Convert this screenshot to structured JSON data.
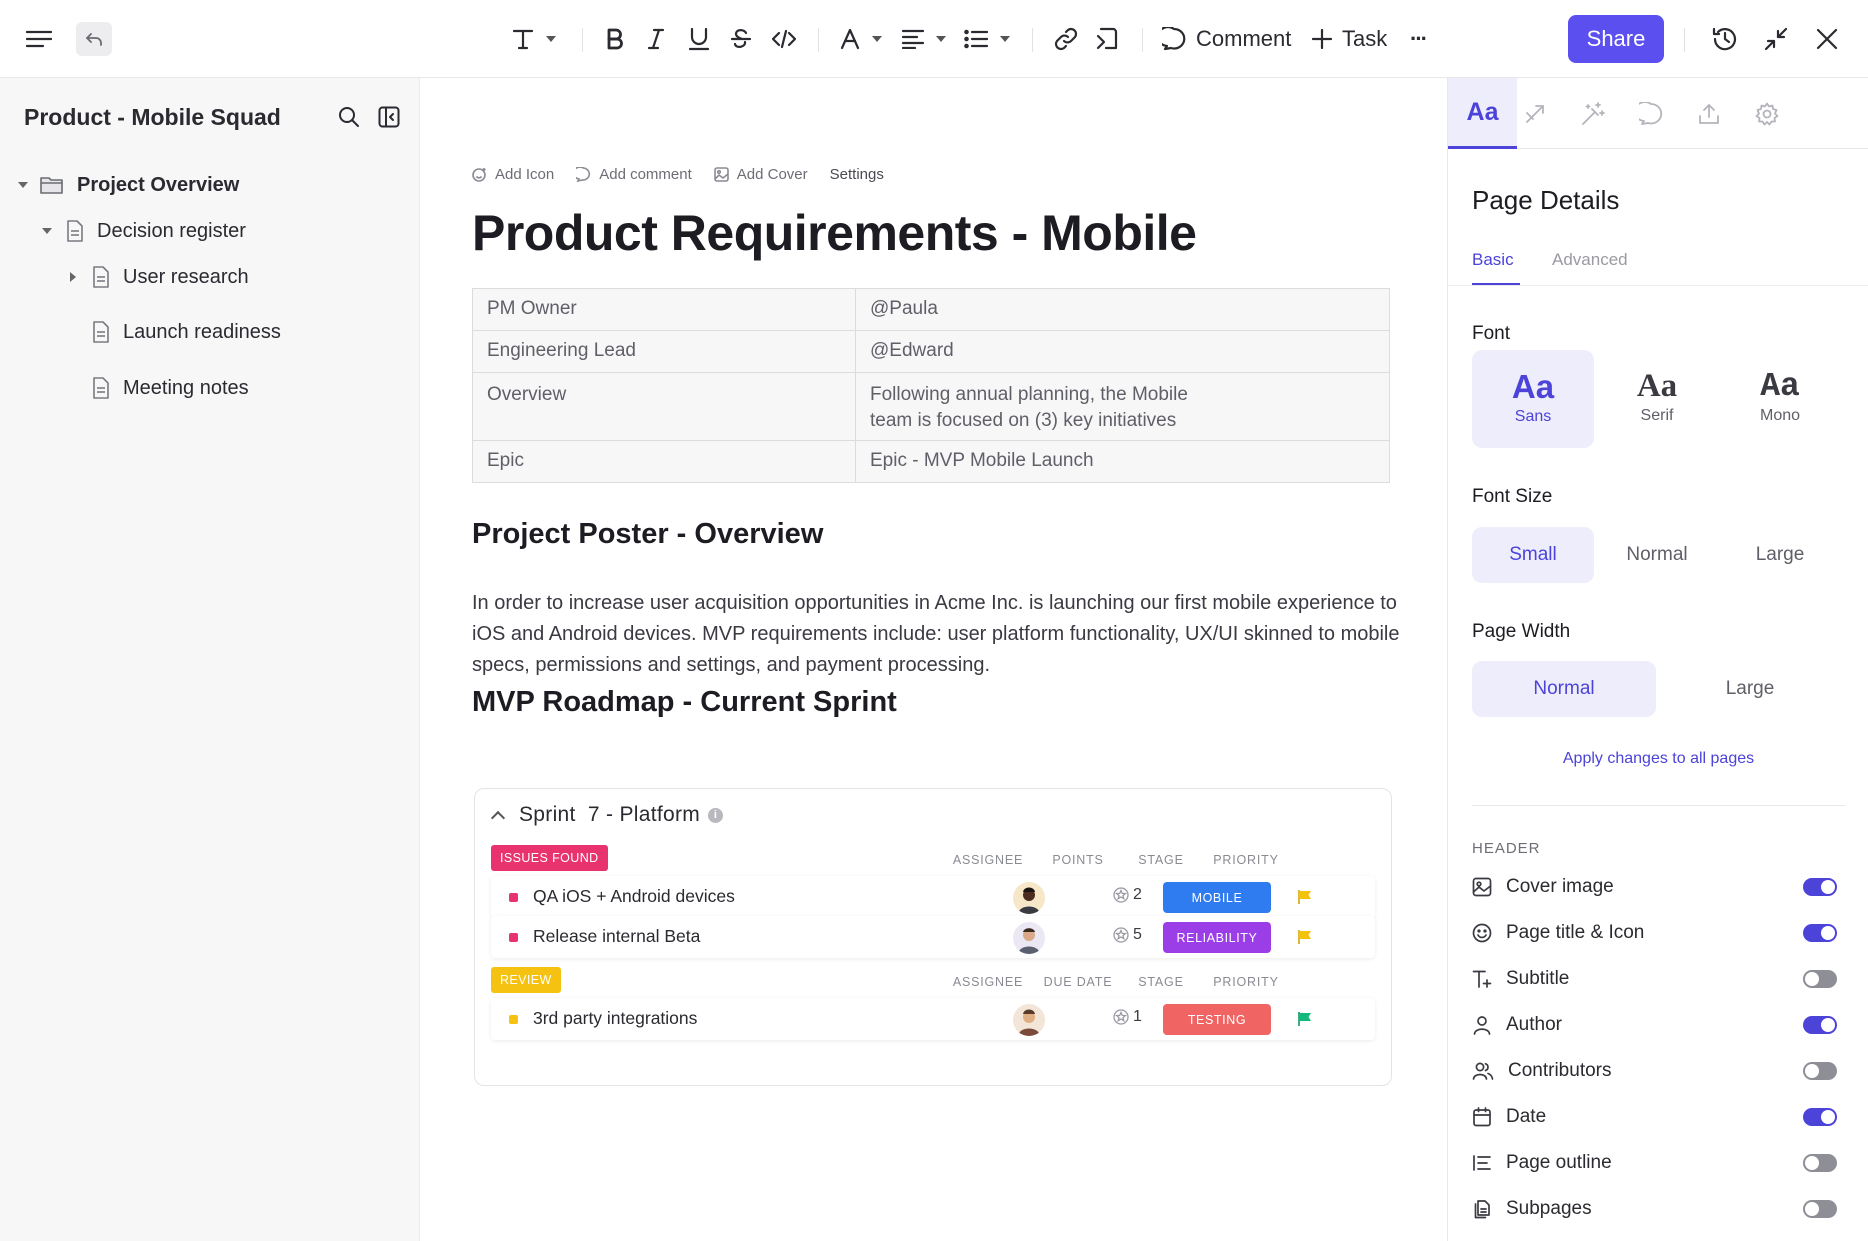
{
  "toolbar": {
    "comment_label": "Comment",
    "task_label": "Task",
    "more_label": "···",
    "share_label": "Share"
  },
  "sidebar": {
    "title": "Product - Mobile Squad",
    "tree": [
      {
        "label": "Project Overview",
        "level": 0,
        "expanded": true
      },
      {
        "label": "Decision register",
        "level": 1,
        "expanded": true
      },
      {
        "label": "User research",
        "level": 2,
        "expanded": false
      },
      {
        "label": "Launch readiness",
        "level": 2
      },
      {
        "label": "Meeting notes",
        "level": 2
      }
    ]
  },
  "doc": {
    "actions": {
      "add_icon": "Add Icon",
      "add_comment": "Add comment",
      "add_cover": "Add Cover",
      "settings": "Settings"
    },
    "title": "Product Requirements - Mobile",
    "properties": [
      {
        "key": "PM Owner",
        "value": "@Paula"
      },
      {
        "key": "Engineering Lead",
        "value": "@Edward"
      },
      {
        "key": "Overview",
        "value_line1": "Following annual planning, the Mobile",
        "value_line2": "team is focused on (3) key initiatives"
      },
      {
        "key": "Epic",
        "value": "Epic - MVP Mobile Launch"
      }
    ],
    "poster_heading": "Project Poster - Overview",
    "poster_body": "In order to increase user acquisition opportunities in Acme Inc. is launching our first mobile experience to iOS and Android devices. MVP requirements include: user platform functionality, UX/UI skinned to mobile specs, permissions and settings, and payment processing.",
    "roadmap_heading": "MVP Roadmap - Current Sprint",
    "sprint": {
      "title": "Sprint  7 - Platform",
      "info_glyph": "i",
      "groups": [
        {
          "tag": "ISSUES FOUND",
          "tag_color": "#e8336f",
          "columns": [
            "ASSIGNEE",
            "POINTS",
            "STAGE",
            "PRIORITY"
          ],
          "tasks": [
            {
              "name": "QA iOS + Android devices",
              "points": "2",
              "stage": "MOBILE",
              "stage_color": "#2f7bf0",
              "square_color": "#e8336f",
              "flag_color": "#f3c20d"
            },
            {
              "name": "Release internal Beta",
              "points": "5",
              "stage": "RELIABILITY",
              "stage_color": "#9b3ee8",
              "square_color": "#e8336f",
              "flag_color": "#f3c20d"
            }
          ]
        },
        {
          "tag": "REVIEW",
          "tag_color": "#f5c211",
          "columns": [
            "ASSIGNEE",
            "DUE DATE",
            "STAGE",
            "PRIORITY"
          ],
          "tasks": [
            {
              "name": "3rd party integrations",
              "points": "1",
              "stage": "TESTING",
              "stage_color": "#f06464",
              "square_color": "#f5c211",
              "flag_color": "#14b87a"
            }
          ]
        }
      ]
    }
  },
  "panel": {
    "active_tab": "Aa",
    "title": "Page Details",
    "subtabs": {
      "basic": "Basic",
      "advanced": "Advanced"
    },
    "font_label": "Font",
    "fonts": [
      {
        "glyph": "Aa",
        "name": "Sans",
        "selected": true
      },
      {
        "glyph": "Aa",
        "name": "Serif",
        "selected": false
      },
      {
        "glyph": "Aa",
        "name": "Mono",
        "selected": false
      }
    ],
    "font_size_label": "Font Size",
    "font_sizes": [
      "Small",
      "Normal",
      "Large"
    ],
    "font_size_selected": "Small",
    "page_width_label": "Page Width",
    "page_widths": [
      "Normal",
      "Large"
    ],
    "page_width_selected": "Normal",
    "apply_link": "Apply changes to all pages",
    "header_label": "HEADER",
    "header_items": [
      {
        "label": "Cover image",
        "on": true,
        "icon": "image-icon"
      },
      {
        "label": "Page title & Icon",
        "on": true,
        "icon": "smiley-icon"
      },
      {
        "label": "Subtitle",
        "on": false,
        "icon": "text-plus-icon"
      },
      {
        "label": "Author",
        "on": true,
        "icon": "user-icon"
      },
      {
        "label": "Contributors",
        "on": false,
        "icon": "users-icon"
      },
      {
        "label": "Date",
        "on": true,
        "icon": "calendar-icon"
      },
      {
        "label": "Page outline",
        "on": false,
        "icon": "outline-icon"
      },
      {
        "label": "Subpages",
        "on": false,
        "icon": "pages-icon"
      }
    ],
    "accent_color": "#4c43d8"
  }
}
